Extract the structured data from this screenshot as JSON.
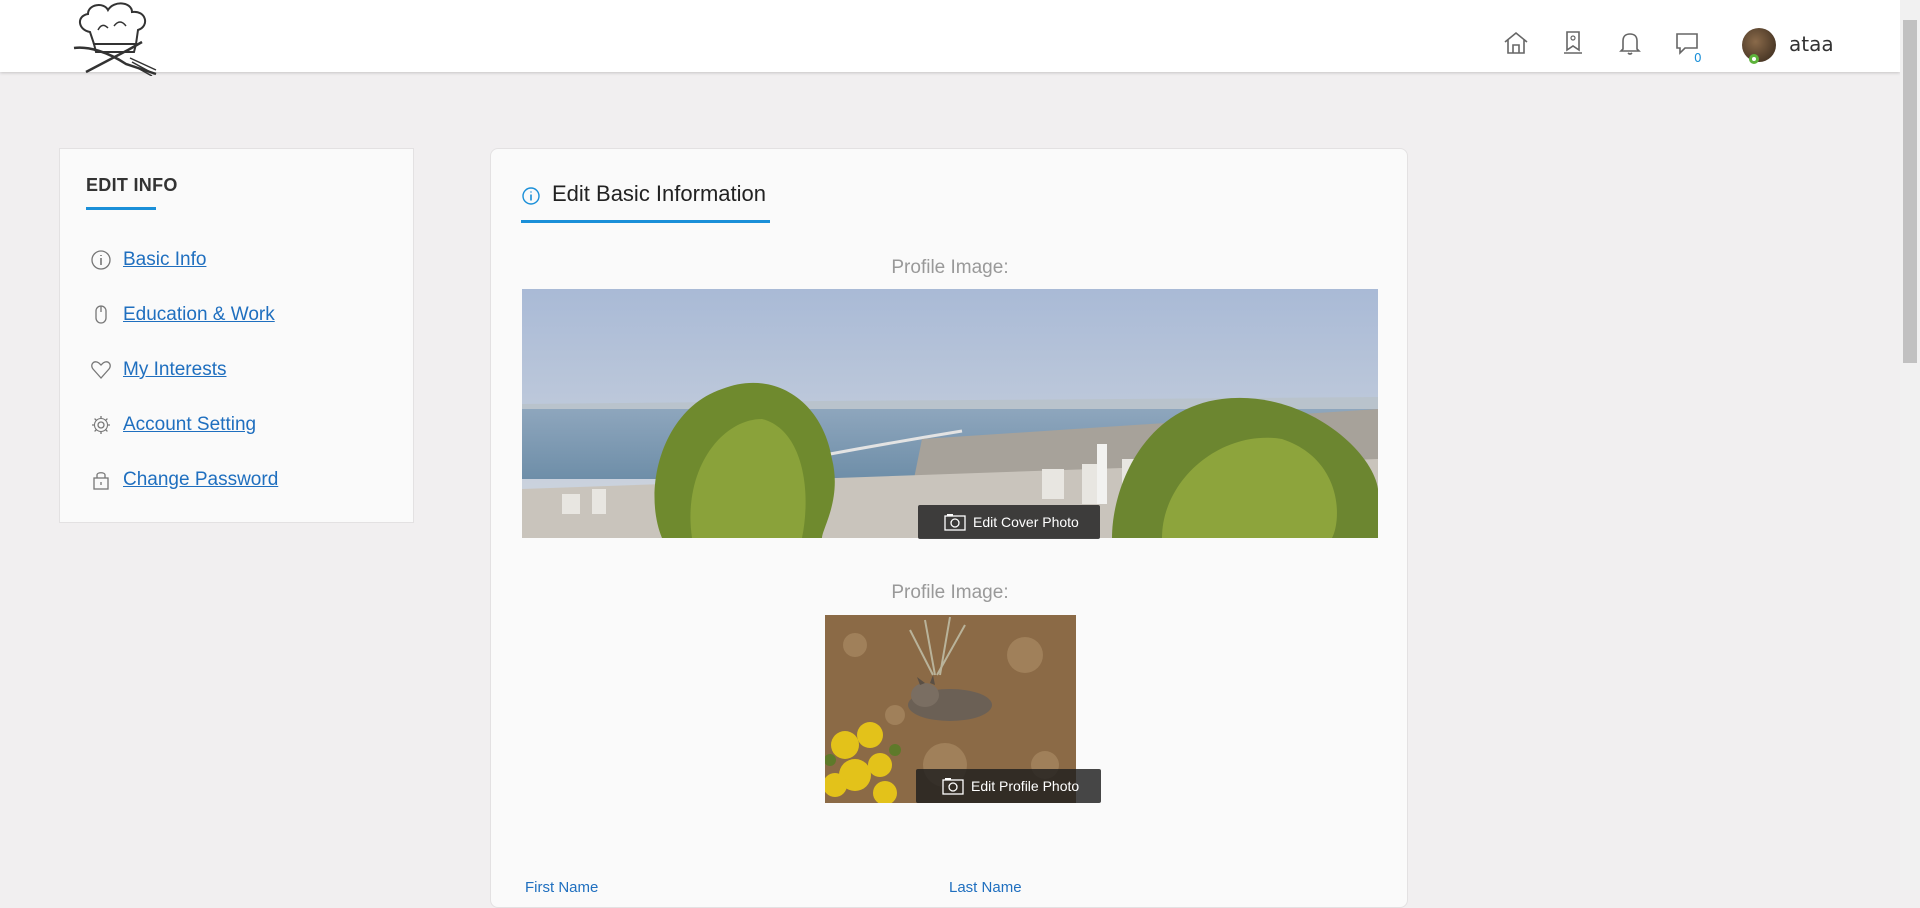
{
  "header": {
    "nav": [
      {
        "name": "home-icon"
      },
      {
        "name": "saved-icon"
      },
      {
        "name": "notifications-icon"
      },
      {
        "name": "messages-icon"
      }
    ],
    "message_count": "0",
    "username": "ataa",
    "online_color": "#5db33a"
  },
  "sidebar": {
    "title": "EDIT INFO",
    "items": [
      {
        "label": "Basic Info",
        "icon": "info-icon"
      },
      {
        "label": "Education & Work",
        "icon": "mouse-icon"
      },
      {
        "label": "My Interests",
        "icon": "heart-icon"
      },
      {
        "label": "Account Setting",
        "icon": "gear-icon"
      },
      {
        "label": "Change Password",
        "icon": "lock-icon"
      }
    ]
  },
  "main": {
    "title": "Edit Basic Information",
    "cover_label": "Profile Image:",
    "edit_cover_label": "Edit Cover Photo",
    "profile_label": "Profile Image:",
    "edit_profile_label": "Edit Profile Photo",
    "first_name_label": "First Name",
    "last_name_label": "Last Name"
  },
  "colors": {
    "accent": "#1a8fd8",
    "link": "#1f6fbf",
    "background": "#f1eff0"
  }
}
